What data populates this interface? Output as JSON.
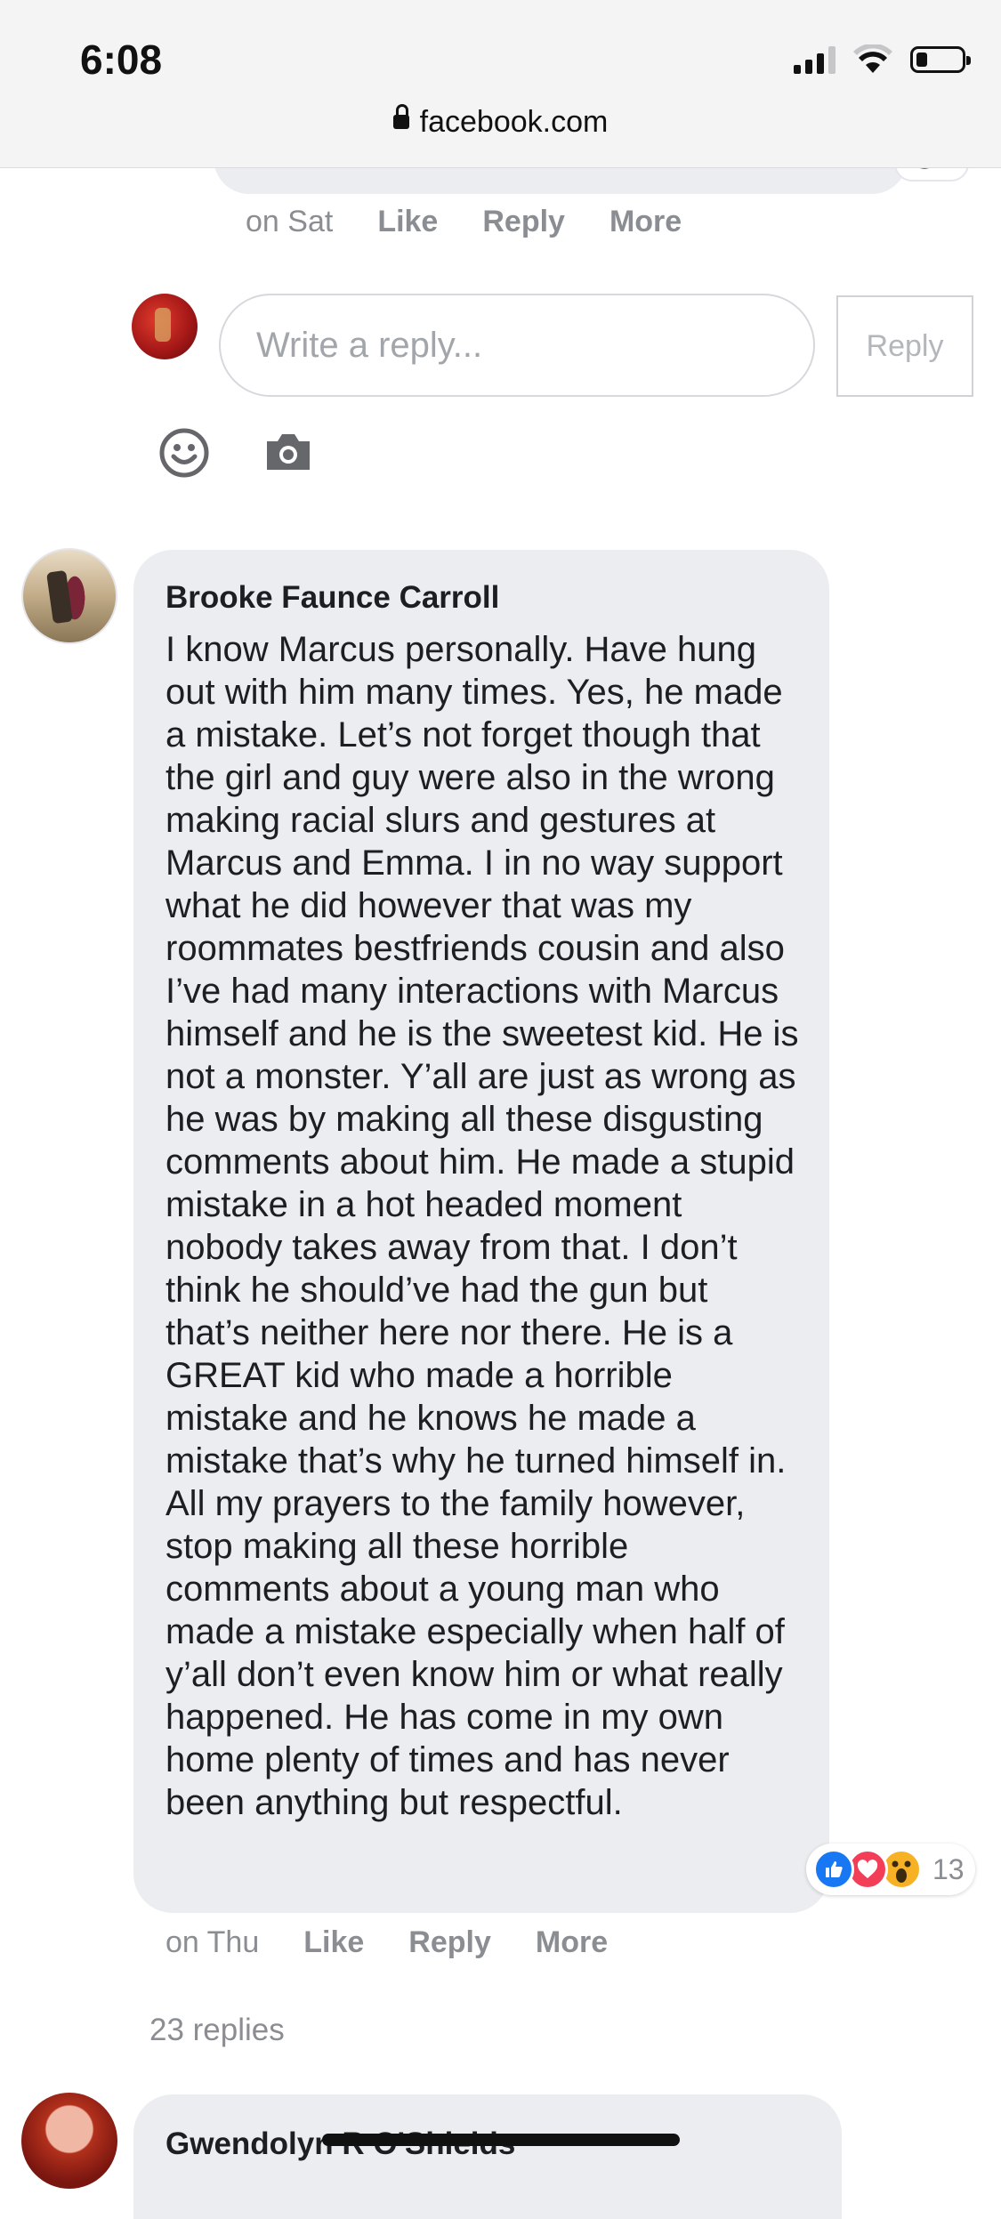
{
  "status_bar": {
    "time": "6:08"
  },
  "browser": {
    "url": "facebook.com"
  },
  "previous_comment": {
    "timestamp": "on Sat",
    "like": "Like",
    "reply": "Reply",
    "more": "More"
  },
  "reply_composer": {
    "placeholder": "Write a reply...",
    "button": "Reply"
  },
  "comment": {
    "author": "Brooke Faunce Carroll",
    "text": "I know Marcus personally. Have hung out with him many times. Yes, he made a mistake. Let’s not forget though that the girl and guy were also in the wrong making racial slurs and gestures at Marcus and Emma. I in no way support what he did however that was my roommates bestfriends cousin and also I’ve had many interactions with Marcus himself and he is the sweetest kid. He is not a monster. Y’all are just as wrong as he was by making all these disgusting comments about him. He made a stupid mistake in a hot headed moment nobody takes away from that. I don’t think he should’ve had the gun but that’s neither here nor there. He is a GREAT kid who made a horrible mistake and he knows he made a mistake that’s why he turned himself in. All my prayers to the family however, stop making all these horrible comments about a young man who made a mistake especially when half of y’all don’t even know him or what really happened. He has come in my own home plenty of times and has never been anything but respectful.",
    "reaction_count": "13",
    "timestamp": "on Thu",
    "like": "Like",
    "reply": "Reply",
    "more": "More",
    "replies_link": "23 replies"
  },
  "next_comment": {
    "author": "Gwendolyn R O'Shields"
  },
  "colors": {
    "bubble": "#ebedf0",
    "muted_text": "#8a8d91",
    "facebook_blue": "#1877f2",
    "love_red": "#f33e58",
    "wow_yellow": "#f7b125"
  },
  "icons": [
    "lock-icon",
    "signal-icon",
    "wifi-icon",
    "battery-icon",
    "emoji-icon",
    "camera-icon",
    "like-reaction-icon",
    "love-reaction-icon",
    "wow-reaction-icon"
  ]
}
